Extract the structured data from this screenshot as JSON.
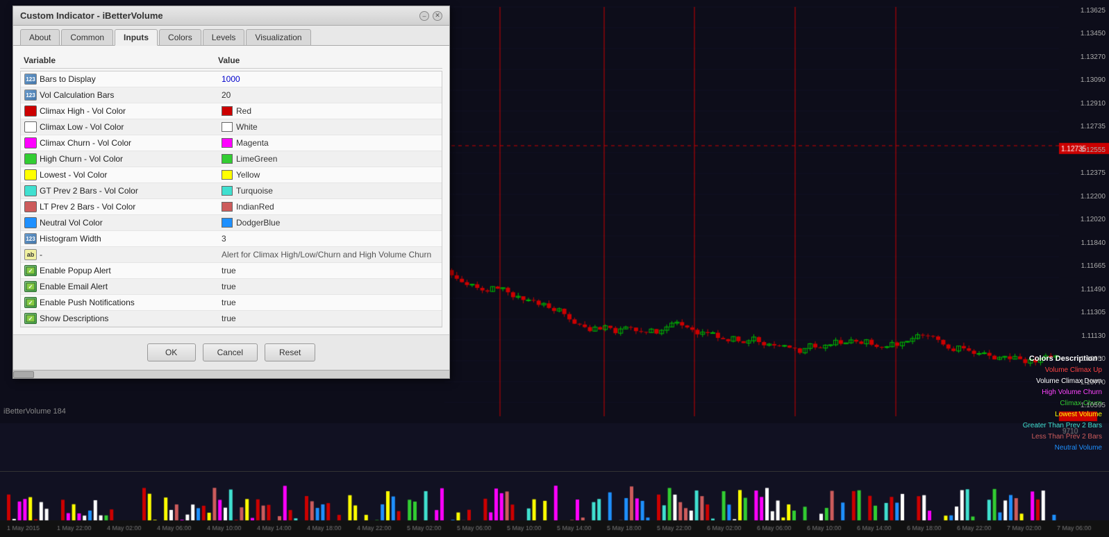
{
  "dialog": {
    "title": "Custom Indicator - iBetterVolume",
    "tabs": [
      {
        "id": "about",
        "label": "About",
        "active": false
      },
      {
        "id": "common",
        "label": "Common",
        "active": false
      },
      {
        "id": "inputs",
        "label": "Inputs",
        "active": true
      },
      {
        "id": "colors",
        "label": "Colors",
        "active": false
      },
      {
        "id": "levels",
        "label": "Levels",
        "active": false
      },
      {
        "id": "visualization",
        "label": "Visualization",
        "active": false
      }
    ],
    "table": {
      "col_variable": "Variable",
      "col_value": "Value"
    },
    "params": [
      {
        "icon_type": "int",
        "name": "Bars to Display",
        "value": "1000",
        "value_type": "number_blue"
      },
      {
        "icon_type": "int",
        "name": "Vol Calculation Bars",
        "value": "20",
        "value_type": "number_orange"
      },
      {
        "icon_type": "color",
        "name": "Climax High - Vol Color",
        "value": "Red",
        "color": "#cc0000",
        "value_type": "color"
      },
      {
        "icon_type": "color",
        "name": "Climax Low - Vol Color",
        "value": "White",
        "color": "#ffffff",
        "value_type": "color"
      },
      {
        "icon_type": "color",
        "name": "Climax Churn - Vol Color",
        "value": "Magenta",
        "color": "#ff00ff",
        "value_type": "color"
      },
      {
        "icon_type": "color",
        "name": "High Churn - Vol Color",
        "value": "LimeGreen",
        "color": "#32cd32",
        "value_type": "color"
      },
      {
        "icon_type": "color",
        "name": "Lowest - Vol Color",
        "value": "Yellow",
        "color": "#ffff00",
        "value_type": "color"
      },
      {
        "icon_type": "color",
        "name": "GT Prev 2 Bars - Vol Color",
        "value": "Turquoise",
        "color": "#40e0d0",
        "value_type": "color"
      },
      {
        "icon_type": "color",
        "name": "LT Prev 2 Bars - Vol Color",
        "value": "IndianRed",
        "color": "#cd5c5c",
        "value_type": "color"
      },
      {
        "icon_type": "color",
        "name": "Neutral Vol Color",
        "value": "DodgerBlue",
        "color": "#1e90ff",
        "value_type": "color"
      },
      {
        "icon_type": "int",
        "name": "Histogram Width",
        "value": "3",
        "value_type": "number_orange"
      },
      {
        "icon_type": "ab",
        "name": "-",
        "value": "Alert for Climax High/Low/Churn and High Volume Churn",
        "value_type": "alert_label"
      },
      {
        "icon_type": "bool",
        "name": "Enable Popup Alert",
        "value": "true",
        "value_type": "bool"
      },
      {
        "icon_type": "bool",
        "name": "Enable Email Alert",
        "value": "true",
        "value_type": "bool"
      },
      {
        "icon_type": "bool",
        "name": "Enable Push Notifications",
        "value": "true",
        "value_type": "bool"
      },
      {
        "icon_type": "bool",
        "name": "Show Descriptions",
        "value": "true",
        "value_type": "bool"
      }
    ],
    "buttons": {
      "ok": "OK",
      "cancel": "Cancel",
      "reset": "Reset"
    }
  },
  "chart": {
    "indicator_label": "iBetterVolume 184",
    "legend": {
      "title": "Colors Description :",
      "items": [
        {
          "label": "Volume Climax Up",
          "color": "#ff4444"
        },
        {
          "label": "Volume Climax Down",
          "color": "#ffffff"
        },
        {
          "label": "High Volume Churn",
          "color": "#ff44ff"
        },
        {
          "label": "Climax Churn",
          "color": "#32cd32"
        },
        {
          "label": "Lowest Volume",
          "color": "#ffff00"
        },
        {
          "label": "Greater Than Prev 2 Bars",
          "color": "#40e0d0"
        },
        {
          "label": "Less Than Prev 2 Bars",
          "color": "#cd5c5c"
        },
        {
          "label": "Neutral Volume",
          "color": "#1e90ff"
        }
      ]
    },
    "price_labels": [
      "1.13625",
      "1.13450",
      "1.13270",
      "1.13090",
      "1.12910",
      "1.12735",
      "1.12555",
      "1.12375",
      "1.12200",
      "1.12020",
      "1.11840",
      "1.11665",
      "1.11490",
      "1.11305",
      "1.11130",
      "1.10950",
      "1.10770",
      "1.10595"
    ],
    "time_labels": [
      "1 May 2015",
      "1 May 22:00",
      "4 May 02:00",
      "4 May 06:00",
      "4 May 10:00",
      "4 May 14:00",
      "4 May 18:00",
      "4 May 22:00",
      "5 May 02:00",
      "5 May 06:00",
      "5 May 10:00",
      "5 May 14:00",
      "5 May 18:00",
      "5 May 22:00",
      "6 May 02:00",
      "6 May 06:00",
      "6 May 10:00",
      "6 May 14:00",
      "6 May 18:00",
      "6 May 22:00",
      "7 May 02:00",
      "7 May 06:00"
    ]
  }
}
